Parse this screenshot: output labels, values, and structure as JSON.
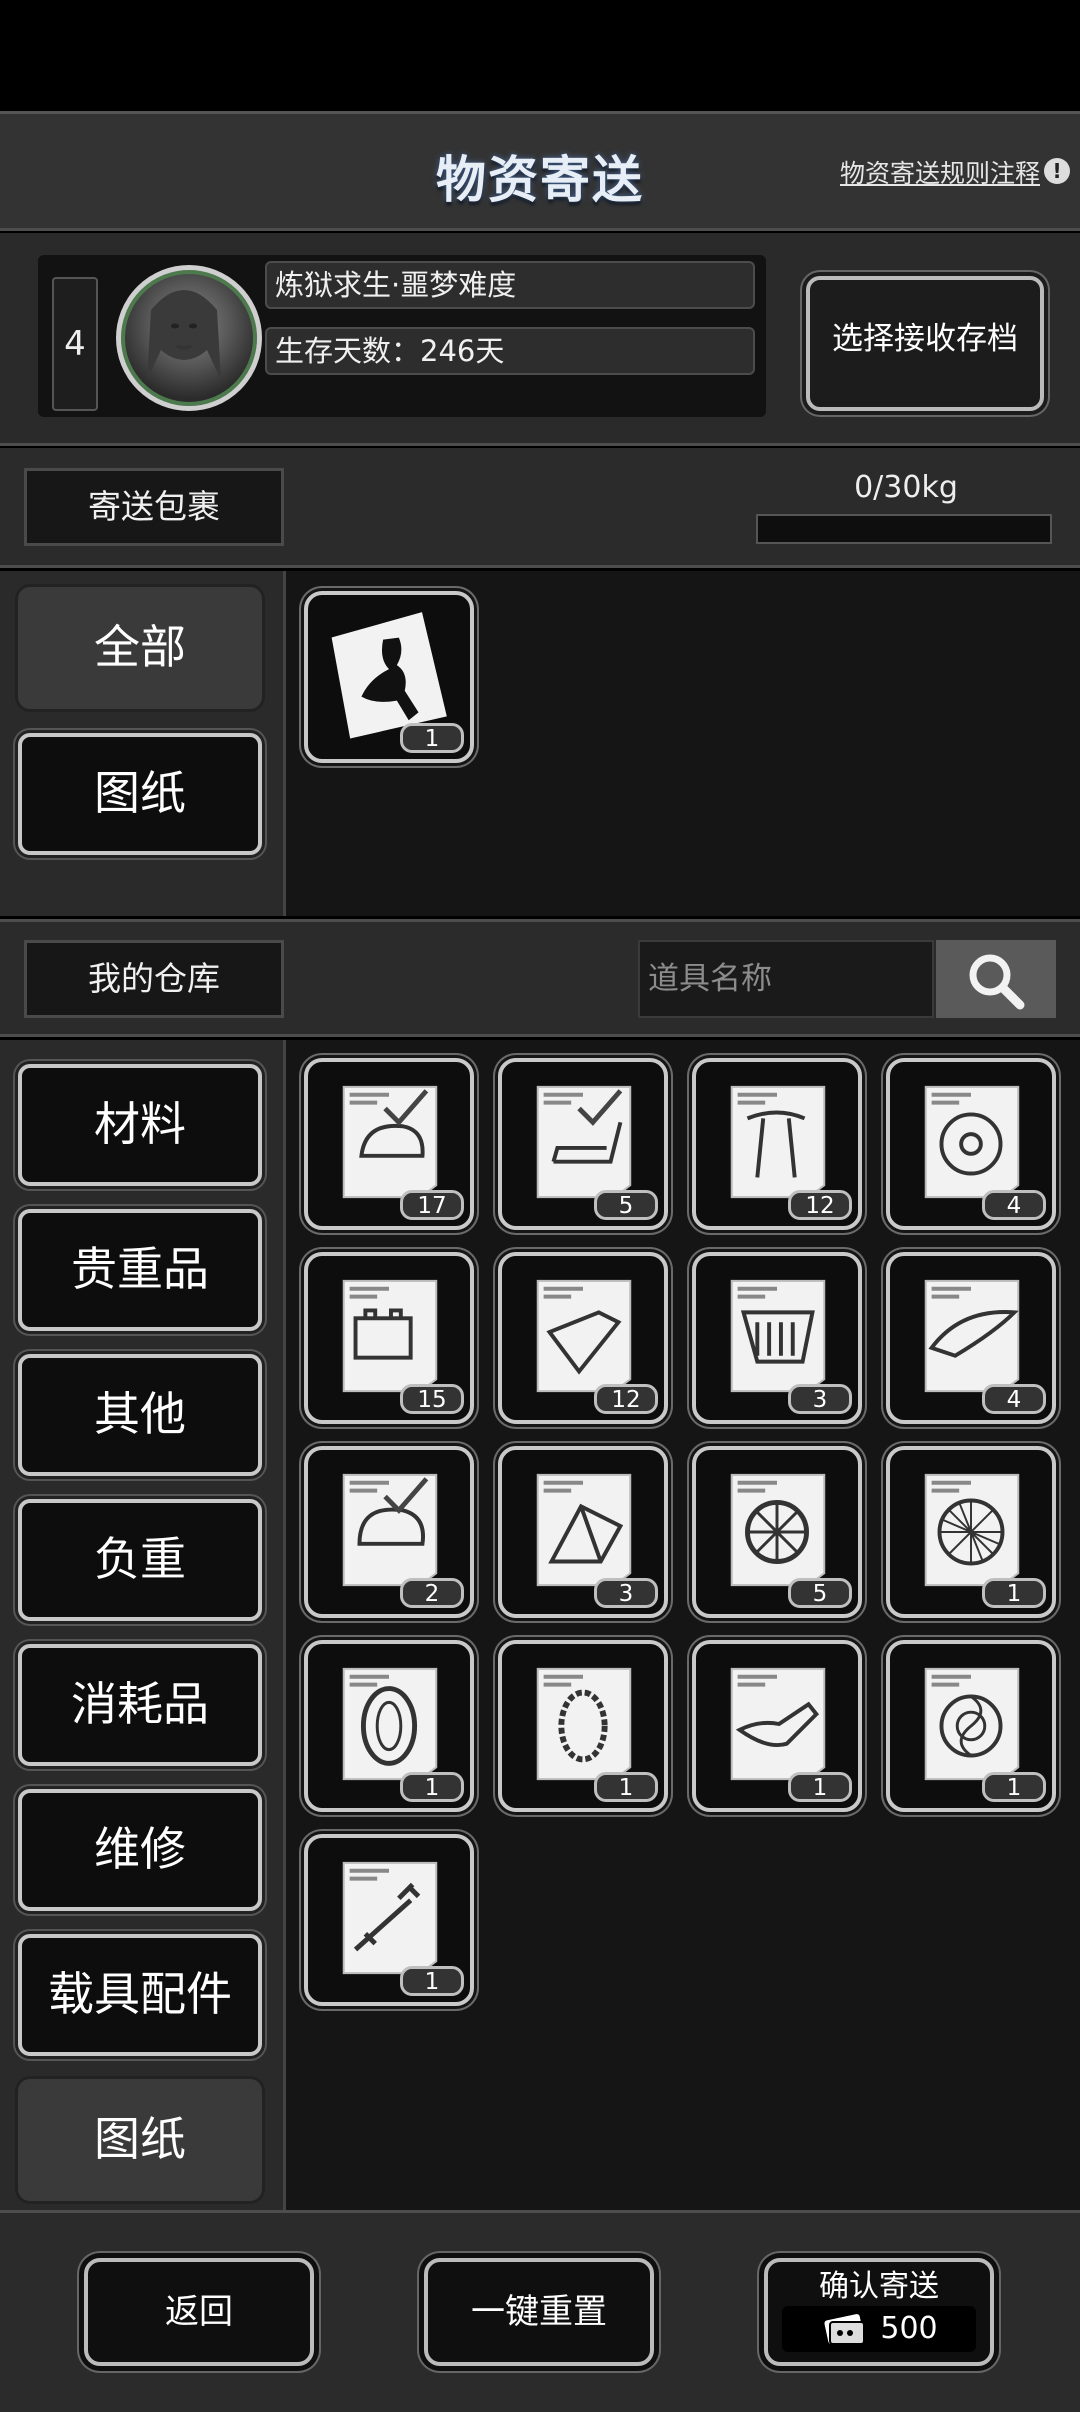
{
  "header": {
    "title": "物资寄送",
    "rules_link": "物资寄送规则注释",
    "rules_icon": "!"
  },
  "profile": {
    "slot": "4",
    "mode": "炼狱求生·噩梦难度",
    "days": "生存天数：246天",
    "receive_button": "选择接收存档"
  },
  "package": {
    "label": "寄送包裹",
    "weight_text": "0/30kg",
    "weight_fraction": 0.0,
    "categories": [
      "全部",
      "图纸"
    ],
    "items": [
      {
        "icon": "blueprint-rabbit-icon",
        "count": "1"
      }
    ]
  },
  "warehouse": {
    "label": "我的仓库",
    "search_placeholder": "道具名称",
    "categories": [
      "材料",
      "贵重品",
      "其他",
      "负重",
      "消耗品",
      "维修",
      "载具配件",
      "图纸"
    ],
    "items": [
      {
        "icon": "blueprint-helmet-icon",
        "count": "17"
      },
      {
        "icon": "blueprint-seat-icon",
        "count": "5"
      },
      {
        "icon": "blueprint-handlebar-icon",
        "count": "12"
      },
      {
        "icon": "blueprint-rim-icon",
        "count": "4"
      },
      {
        "icon": "blueprint-battery-icon",
        "count": "15"
      },
      {
        "icon": "blueprint-fork-icon",
        "count": "12"
      },
      {
        "icon": "blueprint-basket-icon",
        "count": "3"
      },
      {
        "icon": "blueprint-fender-icon",
        "count": "4"
      },
      {
        "icon": "blueprint-helmet2-icon",
        "count": "2"
      },
      {
        "icon": "blueprint-frame-icon",
        "count": "3"
      },
      {
        "icon": "blueprint-wheel-icon",
        "count": "5"
      },
      {
        "icon": "blueprint-spoke-wheel-icon",
        "count": "1"
      },
      {
        "icon": "blueprint-tire-icon",
        "count": "1"
      },
      {
        "icon": "blueprint-tire2-icon",
        "count": "1"
      },
      {
        "icon": "blueprint-pedal-icon",
        "count": "1"
      },
      {
        "icon": "blueprint-disc-icon",
        "count": "1"
      },
      {
        "icon": "blueprint-syringe-icon",
        "count": "1"
      }
    ]
  },
  "footer": {
    "back": "返回",
    "reset": "一键重置",
    "confirm": "确认寄送",
    "cost": "500"
  },
  "colors": {
    "background": "#2b2b2b",
    "panel_dark": "#151515",
    "tile_border": "#c9c9c9",
    "title_glow": "#4a6a9a"
  }
}
